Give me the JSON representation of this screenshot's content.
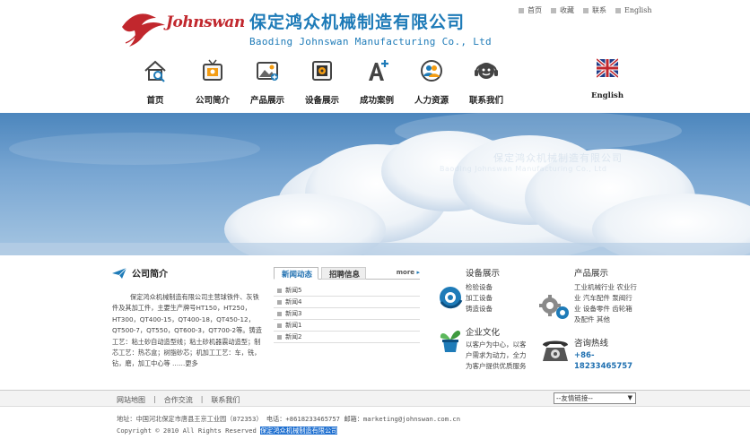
{
  "header": {
    "logo_text": "Johnswan",
    "company_cn": "保定鸿众机械制造有限公司",
    "company_en": "Baoding Johnswan Manufacturing Co., Ltd",
    "top_links": [
      "首页",
      "收藏",
      "联系",
      "English"
    ]
  },
  "nav": {
    "items": [
      {
        "label": "首页",
        "icon": "home-search-icon"
      },
      {
        "label": "公司简介",
        "icon": "tv-icon"
      },
      {
        "label": "产品展示",
        "icon": "image-icon"
      },
      {
        "label": "设备展示",
        "icon": "safe-icon"
      },
      {
        "label": "成功案例",
        "icon": "font-plus-icon"
      },
      {
        "label": "人力资源",
        "icon": "people-icon"
      },
      {
        "label": "联系我们",
        "icon": "headset-icon"
      }
    ],
    "english_label": "English"
  },
  "banner": {
    "watermark_cn": "保定鸿众机械制造有限公司",
    "watermark_en": "Baoding Johnswan Manufacturing Co., Ltd"
  },
  "about": {
    "title": "公司简介",
    "body": "保定鸿众机械制造有限公司主营球铁件、灰铁件及其加工件，主要生产牌号HT150，HT250，HT300，QT400-15，QT400-18，QT450-12，QT500-7，QT550，QT600-3，QT700-2等。铸造工艺：粘土砂自动造型线；粘土砂机器震动造型；制芯工艺：热芯盒；树脂砂芯；机加工工艺：车，铣，钻，磨，加工中心等 ……更多"
  },
  "news": {
    "tab_active": "新闻动态",
    "tab_inactive": "招聘信息",
    "more": "more",
    "items": [
      "新闻5",
      "新闻4",
      "新闻3",
      "新闻1",
      "新闻2"
    ]
  },
  "equipment": {
    "title": "设备展示",
    "lines": [
      "检验设备",
      "加工设备",
      "铸造设备"
    ]
  },
  "culture": {
    "title": "企业文化",
    "text": "以客户为中心，以客户需求为动力，全力为客户提供优质服务"
  },
  "products": {
    "title": "产品展示",
    "text": "工业机械行业 农业行业 汽车配件 泵阀行业 设备零件 齿轮箱及配件 其他"
  },
  "hotline": {
    "title": "咨询热线",
    "number": "+86-18233465757"
  },
  "footer": {
    "links": [
      "网站地图",
      "合作交流",
      "联系我们"
    ],
    "separator": "|",
    "select_value": "--友情链接--",
    "address_line": "地址：中国河北保定市唐县王京工业园（072353）  电话：+8618233465757  邮箱：marketing@johnswan.com.cn",
    "copyright": "Copyright © 2010 All Rights Reserved ",
    "copyright_company": "保定鸿众机械制造有限公司"
  },
  "colors": {
    "brand_blue": "#1e7bb8",
    "logo_red": "#c1272d",
    "news_tab_blue": "#1e6fb0"
  }
}
